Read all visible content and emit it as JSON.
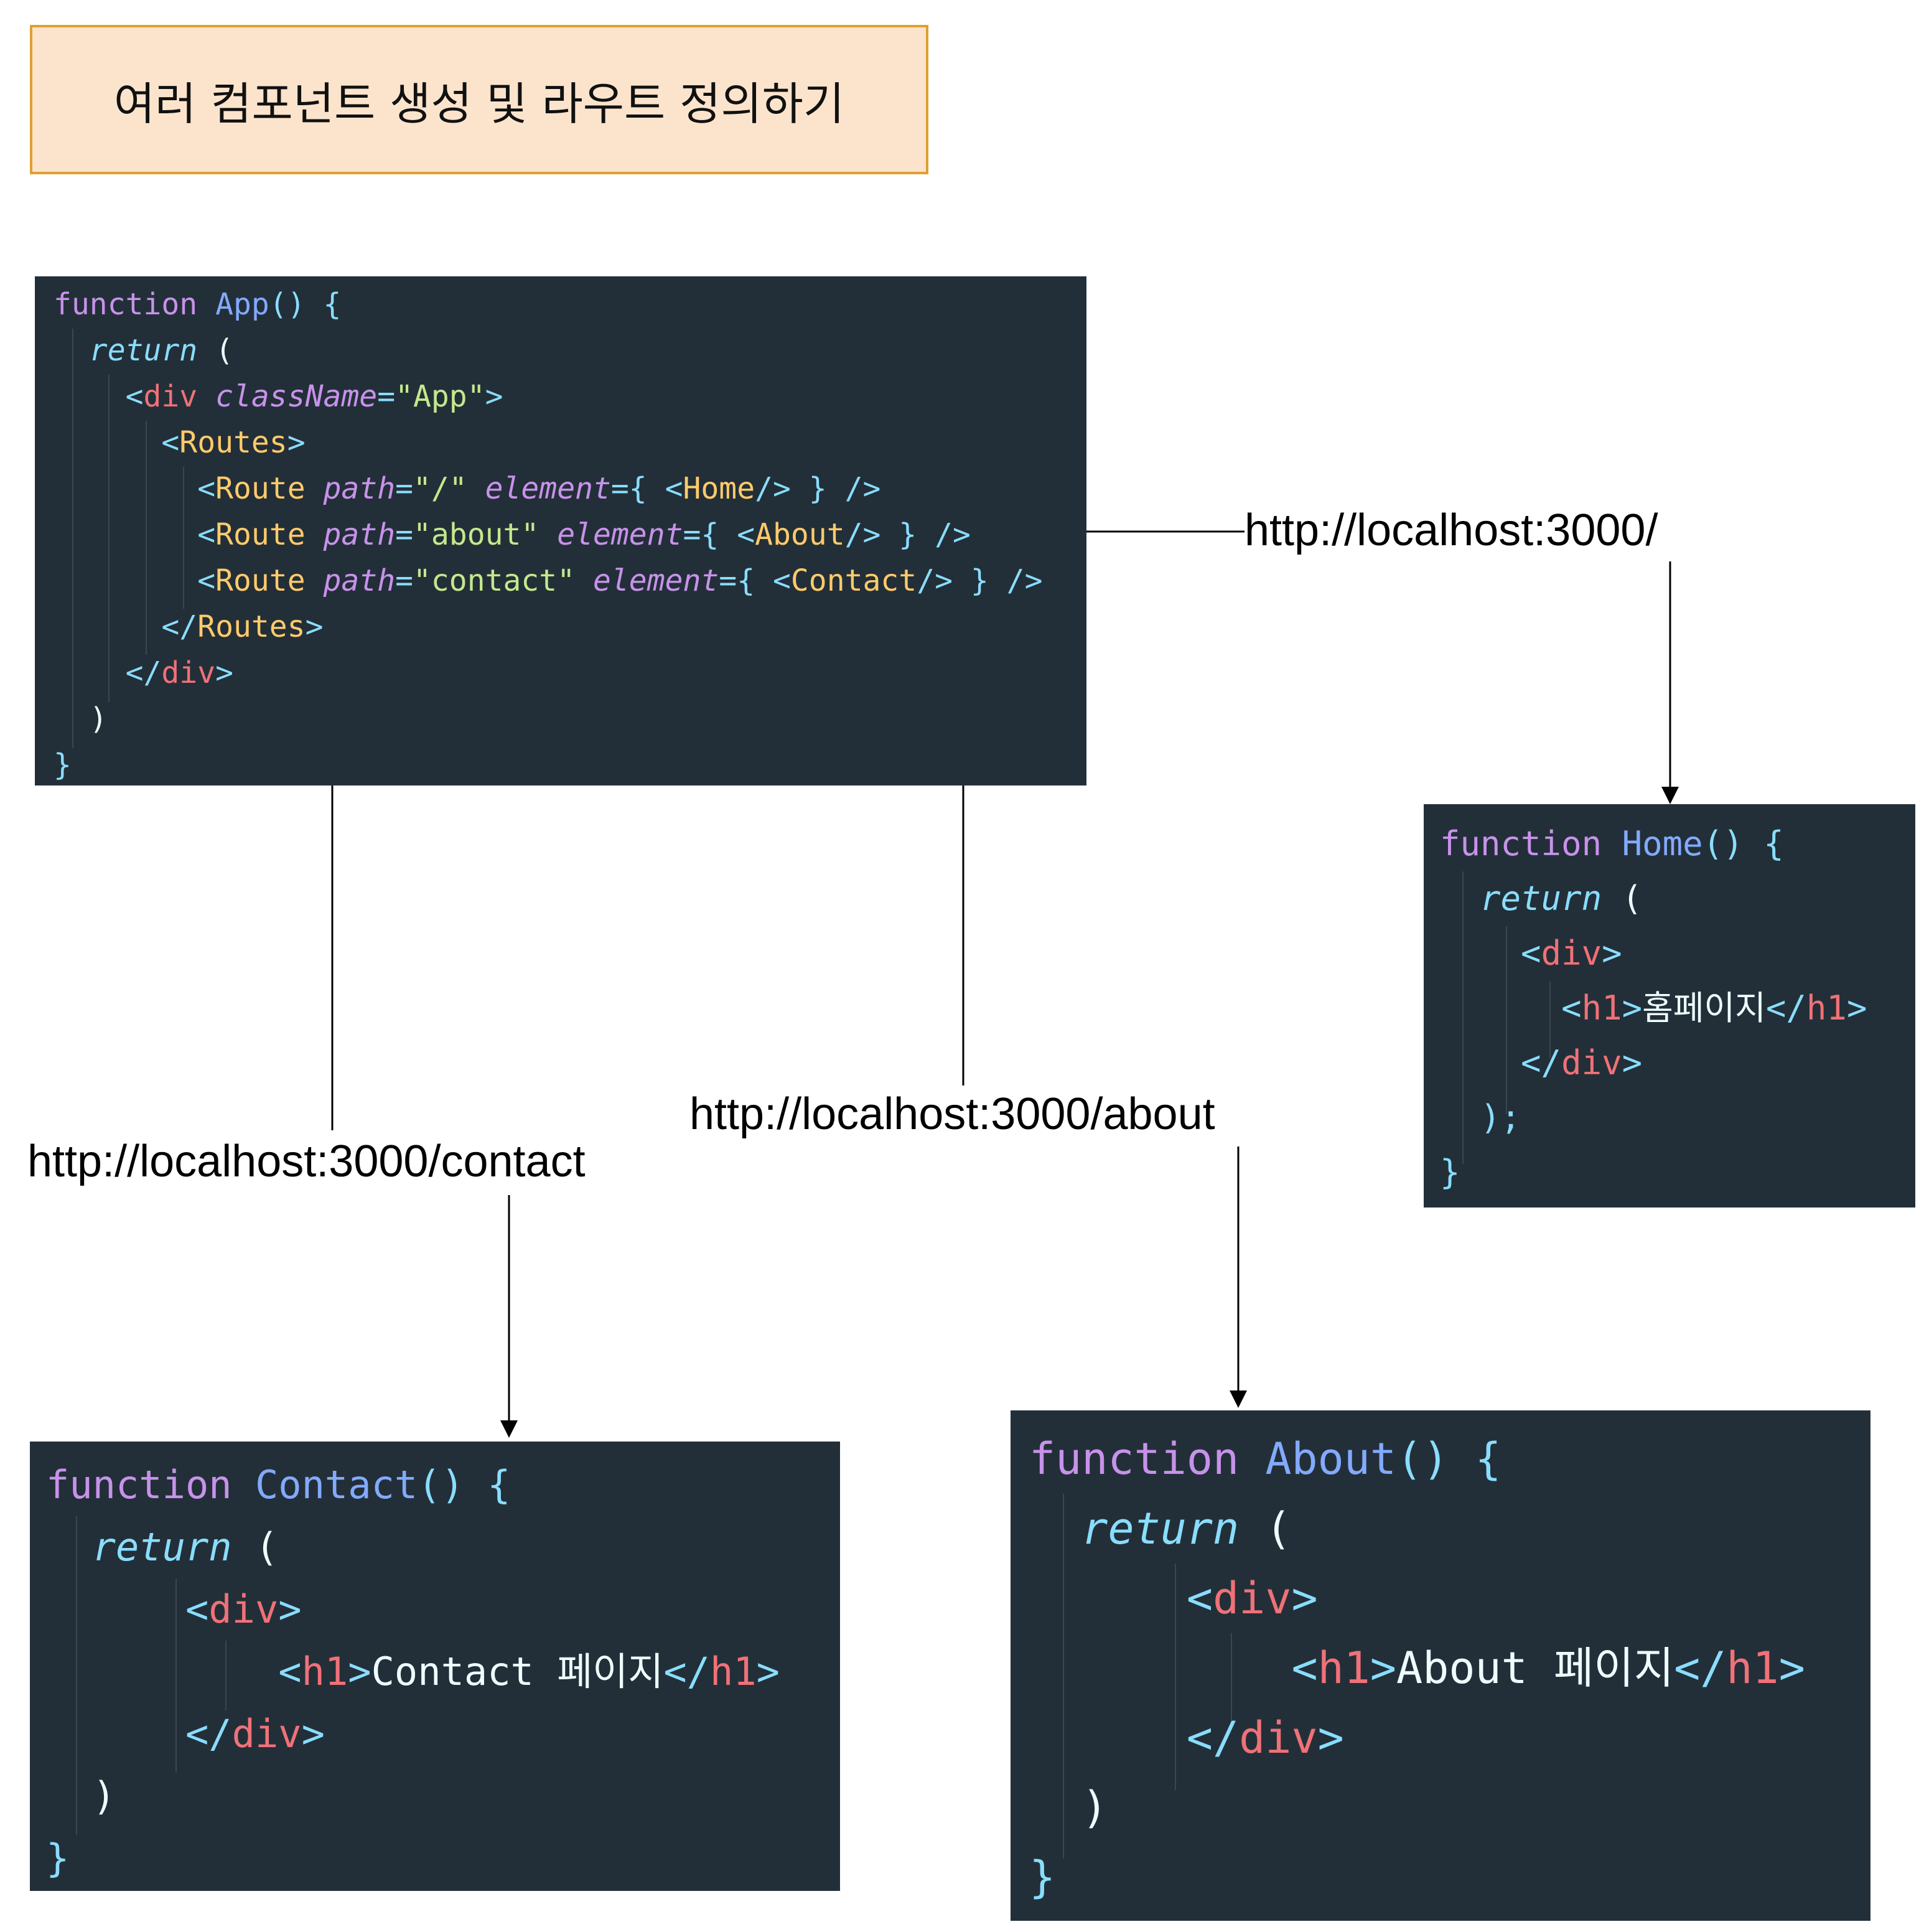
{
  "title": "여러 컴포넌트 생성 및 라우트 정의하기",
  "app_code": {
    "kw_function": "function",
    "name": "App",
    "open": "() {",
    "kw_return": "return",
    "paren_open": "(",
    "div_open_lt": "<",
    "div_tag": "div",
    "attr_classname": "className",
    "eq": "=",
    "classname_value": "\"App\"",
    "gt": ">",
    "routes_tag": "Routes",
    "route_tag": "Route",
    "attr_path": "path",
    "attr_element": "element",
    "route1_path": "\"/\"",
    "route1_comp": "Home",
    "route2_path": "\"about\"",
    "route2_comp": "About",
    "route3_path": "\"contact\"",
    "route3_comp": "Contact",
    "paren_close": ")",
    "brace_close": "}"
  },
  "home_code": {
    "kw_function": "function",
    "name": "Home",
    "open": "() {",
    "kw_return": "return",
    "paren_open": "(",
    "div": "div",
    "h1": "h1",
    "text": "홈페이지",
    "paren_close": ");",
    "brace_close": "}"
  },
  "contact_code": {
    "kw_function": "function",
    "name": "Contact",
    "open": "() {",
    "kw_return": "return",
    "paren_open": "(",
    "div": "div",
    "h1": "h1",
    "text": "Contact 페이지",
    "paren_close": ")",
    "brace_close": "}"
  },
  "about_code": {
    "kw_function": "function",
    "name": "About",
    "open": "() {",
    "kw_return": "return",
    "paren_open": "(",
    "div": "div",
    "h1": "h1",
    "text": "About 페이지",
    "paren_close": ")",
    "brace_close": "}"
  },
  "urls": {
    "home": "http://localhost:3000/",
    "about": "http://localhost:3000/about",
    "contact": "http://localhost:3000/contact"
  }
}
